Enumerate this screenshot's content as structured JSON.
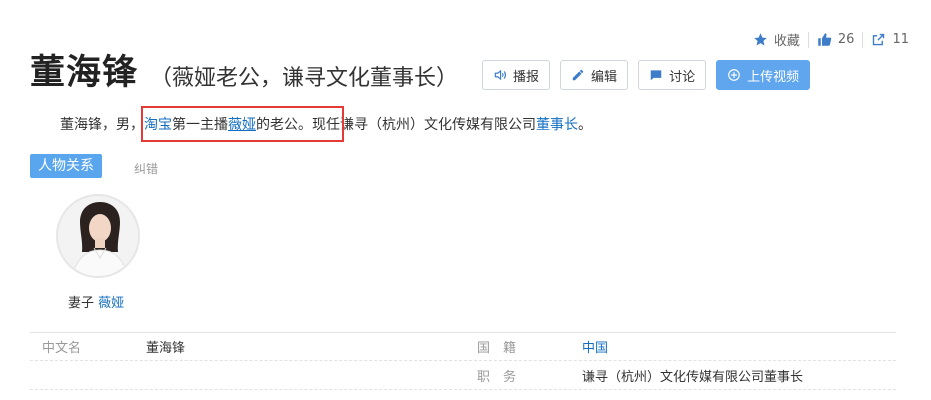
{
  "actions": {
    "favorite_label": "收藏",
    "like_count": "26",
    "share_count": "11"
  },
  "title": {
    "name": "董海锋",
    "subtitle": "（薇娅老公，谦寻文化董事长）"
  },
  "buttons": {
    "broadcast": "播报",
    "edit": "编辑",
    "discuss": "讨论",
    "upload_video": "上传视频"
  },
  "summary": {
    "part1": "董海锋，男，",
    "link_taobao": "淘宝",
    "part2": "第一主播",
    "link_viya": "薇娅",
    "part3": "的老公。现任谦寻（杭州）文化传媒有限公司",
    "link_chairman": "董事长",
    "part4": "。"
  },
  "relations": {
    "tab_label": "人物关系",
    "correct_label": "纠错",
    "person_relation": "妻子",
    "person_name": "薇娅"
  },
  "info_table": {
    "row1": {
      "label1": "中文名",
      "value1": "董海锋",
      "label2": "国　籍",
      "value2": "中国"
    },
    "row2": {
      "label2": "职　务",
      "value2": "谦寻（杭州）文化传媒有限公司董事长"
    }
  },
  "colors": {
    "link": "#136ec2",
    "accent": "#5fa6ee",
    "highlight_box": "#e53935"
  }
}
